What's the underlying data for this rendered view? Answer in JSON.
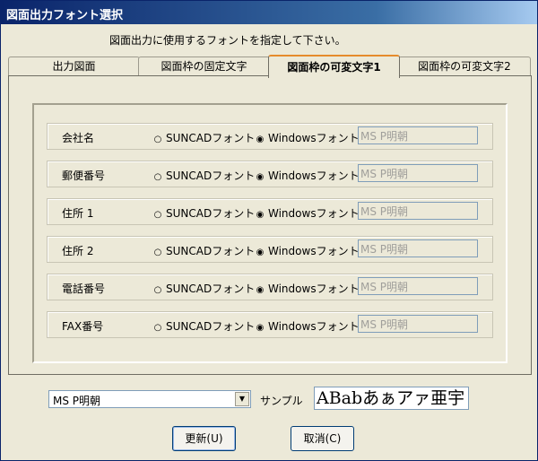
{
  "window": {
    "title": "図面出力フォント選択"
  },
  "instruction": "図面出力に使用するフォントを指定して下さい。",
  "tabs": [
    {
      "label": "出力図面",
      "active": false
    },
    {
      "label": "図面枠の固定文字",
      "active": false
    },
    {
      "label": "図面枠の可変文字1",
      "active": true
    },
    {
      "label": "図面枠の可変文字2",
      "active": false
    }
  ],
  "options": {
    "suncad": "SUNCADフォント",
    "windows": "Windowsフォント"
  },
  "rows": [
    {
      "label": "会社名",
      "selected": "windows",
      "font": "MS P明朝"
    },
    {
      "label": "郵便番号",
      "selected": "windows",
      "font": "MS P明朝"
    },
    {
      "label": "住所 1",
      "selected": "windows",
      "font": "MS P明朝"
    },
    {
      "label": "住所 2",
      "selected": "windows",
      "font": "MS P明朝"
    },
    {
      "label": "電話番号",
      "selected": "windows",
      "font": "MS P明朝"
    },
    {
      "label": "FAX番号",
      "selected": "windows",
      "font": "MS P明朝"
    }
  ],
  "font_select": {
    "value": "MS P明朝"
  },
  "sample": {
    "label": "サンプル",
    "text": "ABabあぁアァ亜宇"
  },
  "buttons": {
    "update": "更新(U)",
    "cancel": "取消(C)"
  }
}
